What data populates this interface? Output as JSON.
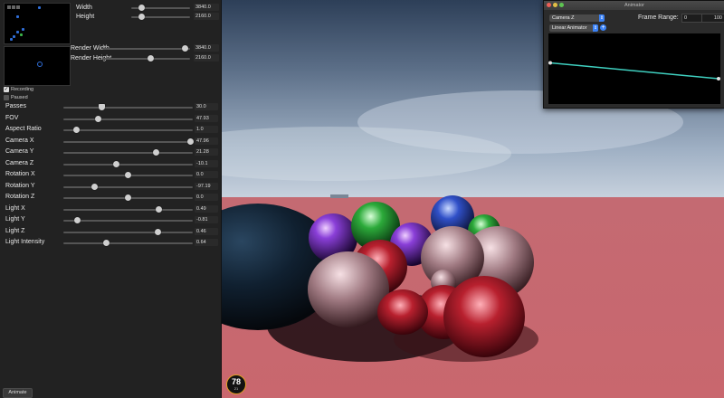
{
  "panel": {
    "output": {
      "width_label": "Width",
      "width_value": "3840.0",
      "width_pct": 0.18,
      "height_label": "Height",
      "height_value": "2160.0",
      "height_pct": 0.18
    },
    "render": {
      "width_label": "Render Width",
      "width_value": "3840.0",
      "width_pct": 0.94,
      "height_label": "Render Height",
      "height_value": "2160.0",
      "height_pct": 0.55
    },
    "recording_label": "Recording",
    "recording_checked": true,
    "paused_label": "Paused",
    "paused_checked": false,
    "sliders": [
      {
        "label": "Passes",
        "value": "30.0",
        "pct": 0.3
      },
      {
        "label": "FOV",
        "value": "47.93",
        "pct": 0.27
      },
      {
        "label": "Aspect Ratio",
        "value": "1.0",
        "pct": 0.1
      },
      {
        "label": "Camera X",
        "value": "47.96",
        "pct": 0.98
      },
      {
        "label": "Camera Y",
        "value": "21.28",
        "pct": 0.72
      },
      {
        "label": "Camera Z",
        "value": "-10.1",
        "pct": 0.41
      },
      {
        "label": "Rotation X",
        "value": "0.0",
        "pct": 0.5
      },
      {
        "label": "Rotation Y",
        "value": "-97.19",
        "pct": 0.24
      },
      {
        "label": "Rotation Z",
        "value": "0.0",
        "pct": 0.5
      },
      {
        "label": "Light X",
        "value": "0.49",
        "pct": 0.74
      },
      {
        "label": "Light Y",
        "value": "-0.81",
        "pct": 0.11
      },
      {
        "label": "Light Z",
        "value": "0.46",
        "pct": 0.73
      },
      {
        "label": "Light Intensity",
        "value": "0.64",
        "pct": 0.33
      }
    ],
    "animate_button": "Animate"
  },
  "fps": {
    "value": "78",
    "sub": "21"
  },
  "animator": {
    "title": "Animator",
    "property_select": "Camera Z",
    "animator_select": "Linear Animator",
    "add_icon": "plus-icon",
    "frame_range_label": "Frame Range:",
    "frame_start": "0",
    "frame_end": "100",
    "curve_color": "#3fd0c0",
    "curve_values": [
      0.48,
      0.23
    ]
  },
  "colors": {
    "accent": "#3b82f6",
    "floor": "#c9666d",
    "sky_top": "#2d3f58"
  }
}
